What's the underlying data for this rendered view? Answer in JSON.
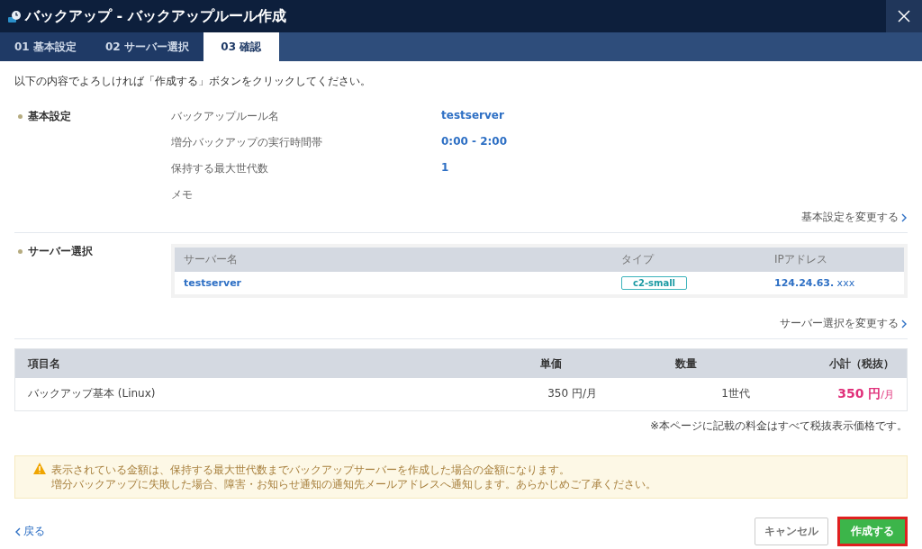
{
  "window": {
    "title": "バックアップ - バックアップルール作成"
  },
  "tabs": [
    {
      "label": "01 基本設定",
      "selected": false
    },
    {
      "label": "02 サーバー選択",
      "selected": false
    },
    {
      "label": "03 確認",
      "selected": true
    }
  ],
  "intro": "以下の内容でよろしければ「作成する」ボタンをクリックしてください。",
  "basic_settings": {
    "heading": "基本設定",
    "rows": [
      {
        "label": "バックアップルール名",
        "value": "testserver"
      },
      {
        "label": "増分バックアップの実行時間帯",
        "value": "0:00 - 2:00"
      },
      {
        "label": "保持する最大世代数",
        "value": "1"
      },
      {
        "label": "メモ"
      }
    ],
    "change_link": "基本設定を変更する"
  },
  "server_selection": {
    "heading": "サーバー選択",
    "columns": [
      "サーバー名",
      "タイプ",
      "IPアドレス"
    ],
    "rows": [
      {
        "name": "testserver",
        "type": "c2-small",
        "ip": "**124.24.63.** xxx"
      }
    ],
    "change_link": "サーバー選択を変更する"
  },
  "price_table": {
    "columns": [
      "項目名",
      "単価",
      "数量",
      "小計（税抜）"
    ],
    "rows": [
      {
        "item": "バックアップ基本 (Linux)",
        "unit_price": "350 円/月",
        "quantity": "1世代",
        "subtotal": "350 円",
        "subtotal_unit": "/月"
      }
    ],
    "note": "※本ページに記載の料金はすべて税抜表示価格です。"
  },
  "warning": {
    "lines": [
      "表示されている金額は、保持する最大世代数までバックアップサーバーを作成した場合の金額になります。",
      "増分バックアップに失敗した場合、障害・お知らせ通知の通知先メールアドレスへ通知します。あらかじめご了承ください。"
    ]
  },
  "footer": {
    "back": "戻る",
    "cancel": "キャンセル",
    "submit": "作成する"
  }
}
